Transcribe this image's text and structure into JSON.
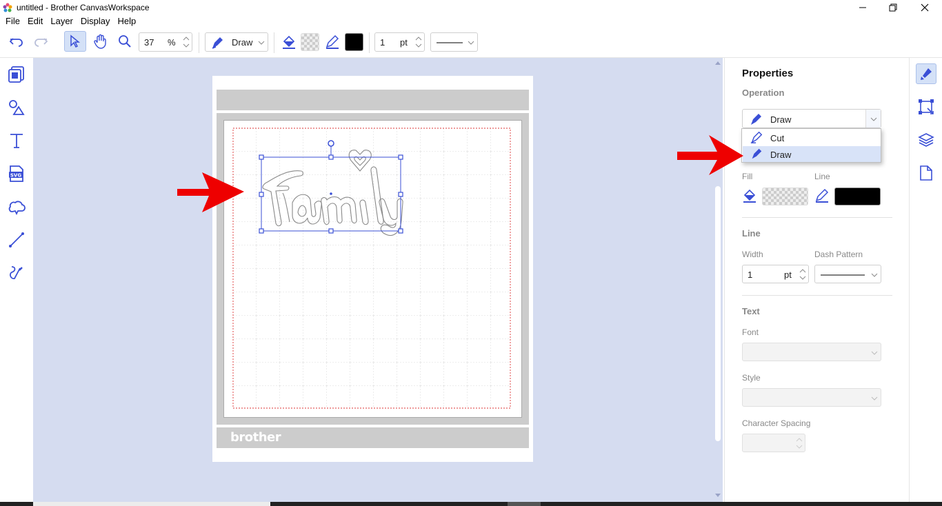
{
  "window": {
    "title": "untitled - Brother CanvasWorkspace",
    "minimize_label": "—",
    "restore_label": "❐",
    "close_label": "✕"
  },
  "menu": [
    "File",
    "Edit",
    "Layer",
    "Display",
    "Help"
  ],
  "toolbar": {
    "zoom_value": "37",
    "zoom_unit": "%",
    "operation_value": "Draw",
    "line_width_value": "1",
    "line_width_unit": "pt",
    "line_color": "#000000",
    "accent": "#3a4fd6"
  },
  "left_tools": [
    "pattern-library-icon",
    "shapes-icon",
    "text-icon",
    "svg-import-icon",
    "cloud-shape-icon",
    "line-icon",
    "freehand-icon"
  ],
  "canvas": {
    "mat_brand": "brother",
    "design_text": "Family",
    "background": "#d5dcf0"
  },
  "properties": {
    "title": "Properties",
    "operation_label": "Operation",
    "operation_value": "Draw",
    "operation_options": [
      "Cut",
      "Draw"
    ],
    "operation_selected": "Draw",
    "fill_label": "Fill",
    "line_label": "Line",
    "line_section_label": "Line",
    "width_label": "Width",
    "width_value": "1",
    "width_unit": "pt",
    "dash_label": "Dash Pattern",
    "text_section_label": "Text",
    "font_label": "Font",
    "style_label": "Style",
    "char_spacing_label": "Character Spacing"
  },
  "right_rail": [
    "paint-brush-icon",
    "transform-icon",
    "layers-icon",
    "page-icon"
  ]
}
